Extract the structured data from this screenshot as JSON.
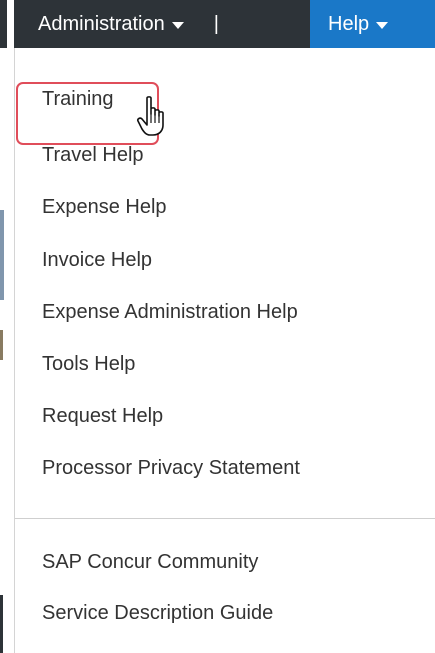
{
  "navbar": {
    "administration_label": "Administration",
    "separator": "|",
    "help_label": "Help"
  },
  "help_menu": {
    "items": [
      {
        "label": "Training"
      },
      {
        "label": "Travel Help"
      },
      {
        "label": "Expense Help"
      },
      {
        "label": "Invoice Help"
      },
      {
        "label": "Expense Administration Help"
      },
      {
        "label": "Tools Help"
      },
      {
        "label": "Request Help"
      },
      {
        "label": "Processor Privacy Statement"
      },
      {
        "label": "SAP Concur Community"
      },
      {
        "label": "Service Description Guide"
      }
    ]
  },
  "icons": {
    "dropdown_caret": "chevron-down-icon",
    "pointer": "hand-cursor-icon"
  },
  "colors": {
    "navbar_bg": "#2d3338",
    "help_active_bg": "#1a78c8",
    "highlight_border": "#e04d5a",
    "menu_text": "#333333"
  }
}
